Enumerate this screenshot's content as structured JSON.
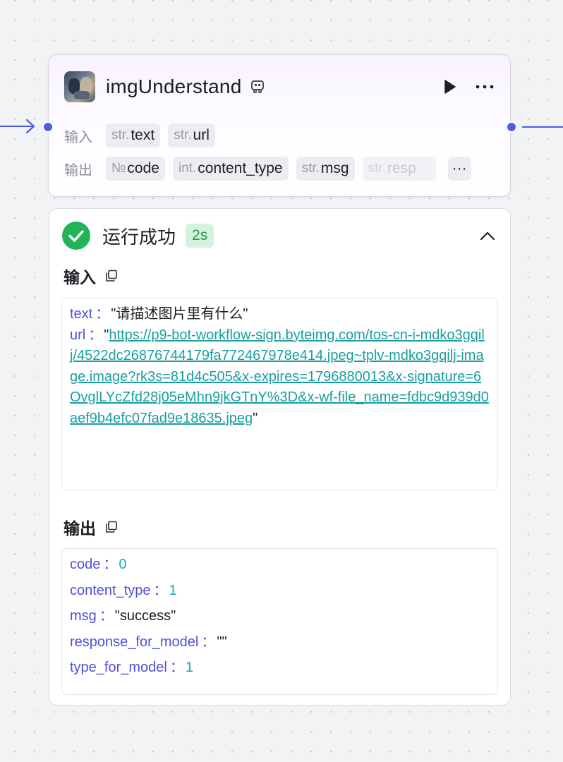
{
  "node": {
    "title": "imgUnderstand",
    "icons": {
      "plugin": "plugin-icon",
      "run": "play-icon",
      "more": "more-icon"
    },
    "input_label": "输入",
    "output_label": "输出",
    "inputs": [
      {
        "type": "str.",
        "name": "text"
      },
      {
        "type": "str.",
        "name": "url"
      }
    ],
    "outputs": [
      {
        "type": "№",
        "name": "code"
      },
      {
        "type": "int.",
        "name": "content_type"
      },
      {
        "type": "str.",
        "name": "msg"
      },
      {
        "type": "str.",
        "name": "resp"
      }
    ],
    "more_label": "···"
  },
  "result": {
    "status": "运行成功",
    "duration": "2s",
    "input_title": "输入",
    "output_title": "输出",
    "input": {
      "text_key": "text",
      "text_value": "\"请描述图片里有什么\"",
      "url_key": "url",
      "url_value": "https://p9-bot-workflow-sign.byteimg.com/tos-cn-i-mdko3gqilj/4522dc26876744179fa772467978e414.jpeg~tplv-mdko3gqilj-image.image?rk3s=81d4c505&x-expires=1796880013&x-signature=6OvglLYcZfd28j05eMhn9jkGTnY%3D&x-wf-file_name=fdbc9d939d0aef9b4efc07fad9e18635.jpeg"
    },
    "output": [
      {
        "key": "code",
        "value": "0",
        "kind": "number"
      },
      {
        "key": "content_type",
        "value": "1",
        "kind": "number"
      },
      {
        "key": "msg",
        "value": "\"success\"",
        "kind": "string"
      },
      {
        "key": "response_for_model",
        "value": "\"\"",
        "kind": "string"
      },
      {
        "key": "type_for_model",
        "value": "1",
        "kind": "number"
      }
    ],
    "colon": "："
  },
  "colors": {
    "accent": "#4e5de8",
    "success": "#22b455",
    "key": "#4f50d8",
    "link": "#1a9e9e"
  }
}
